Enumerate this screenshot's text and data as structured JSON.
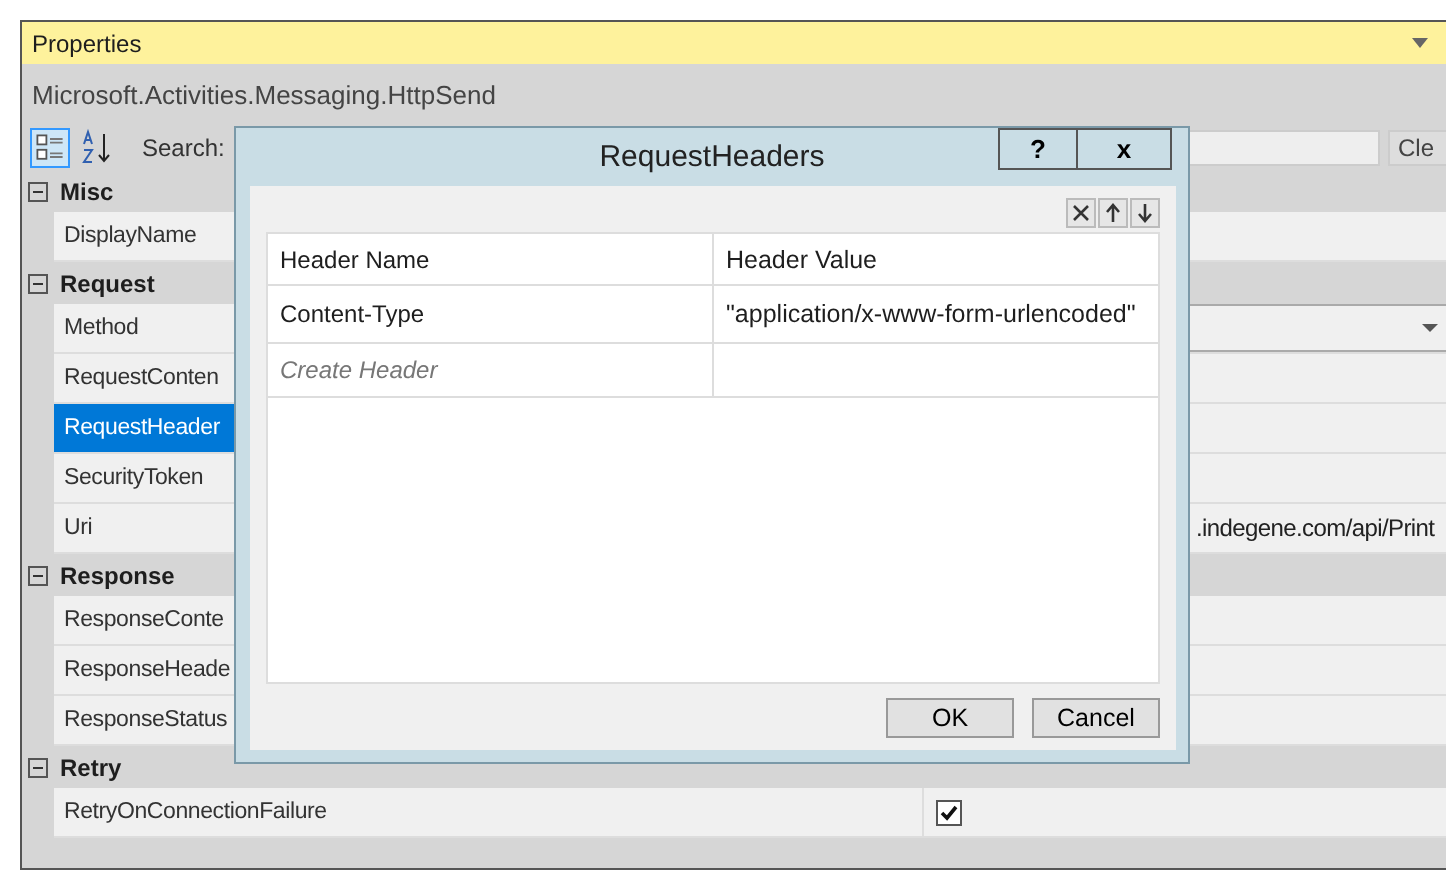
{
  "panel": {
    "title": "Properties",
    "object_name": "Microsoft.Activities.Messaging.HttpSend",
    "search_label": "Search:",
    "clear_button": "Cle"
  },
  "categories": [
    {
      "name": "Misc",
      "expanded": true,
      "properties": [
        {
          "name": "DisplayName",
          "kind": "text",
          "selected": false
        }
      ]
    },
    {
      "name": "Request",
      "expanded": true,
      "properties": [
        {
          "name": "Method",
          "kind": "dropdown",
          "selected": false
        },
        {
          "name": "RequestConten",
          "kind": "text",
          "selected": false
        },
        {
          "name": "RequestHeader",
          "kind": "text",
          "selected": true
        },
        {
          "name": "SecurityToken",
          "kind": "text",
          "selected": false
        },
        {
          "name": "Uri",
          "kind": "text",
          "value": ".indegene.com/api/Print",
          "selected": false
        }
      ]
    },
    {
      "name": "Response",
      "expanded": true,
      "properties": [
        {
          "name": "ResponseConte",
          "kind": "text",
          "selected": false
        },
        {
          "name": "ResponseHeade",
          "kind": "text",
          "selected": false
        },
        {
          "name": "ResponseStatus",
          "kind": "text",
          "selected": false
        }
      ]
    },
    {
      "name": "Retry",
      "expanded": true,
      "properties": [
        {
          "name": "RetryOnConnectionFailure",
          "kind": "checkbox",
          "checked": true,
          "selected": false
        }
      ]
    }
  ],
  "dialog": {
    "title": "RequestHeaders",
    "help_button": "?",
    "close_button": "x",
    "columns": [
      "Header Name",
      "Header Value"
    ],
    "rows": [
      {
        "name": "Content-Type",
        "value": "\"application/x-www-form-urlencoded\""
      }
    ],
    "new_row_placeholder": "Create Header",
    "buttons": [
      "OK",
      "Cancel"
    ]
  }
}
